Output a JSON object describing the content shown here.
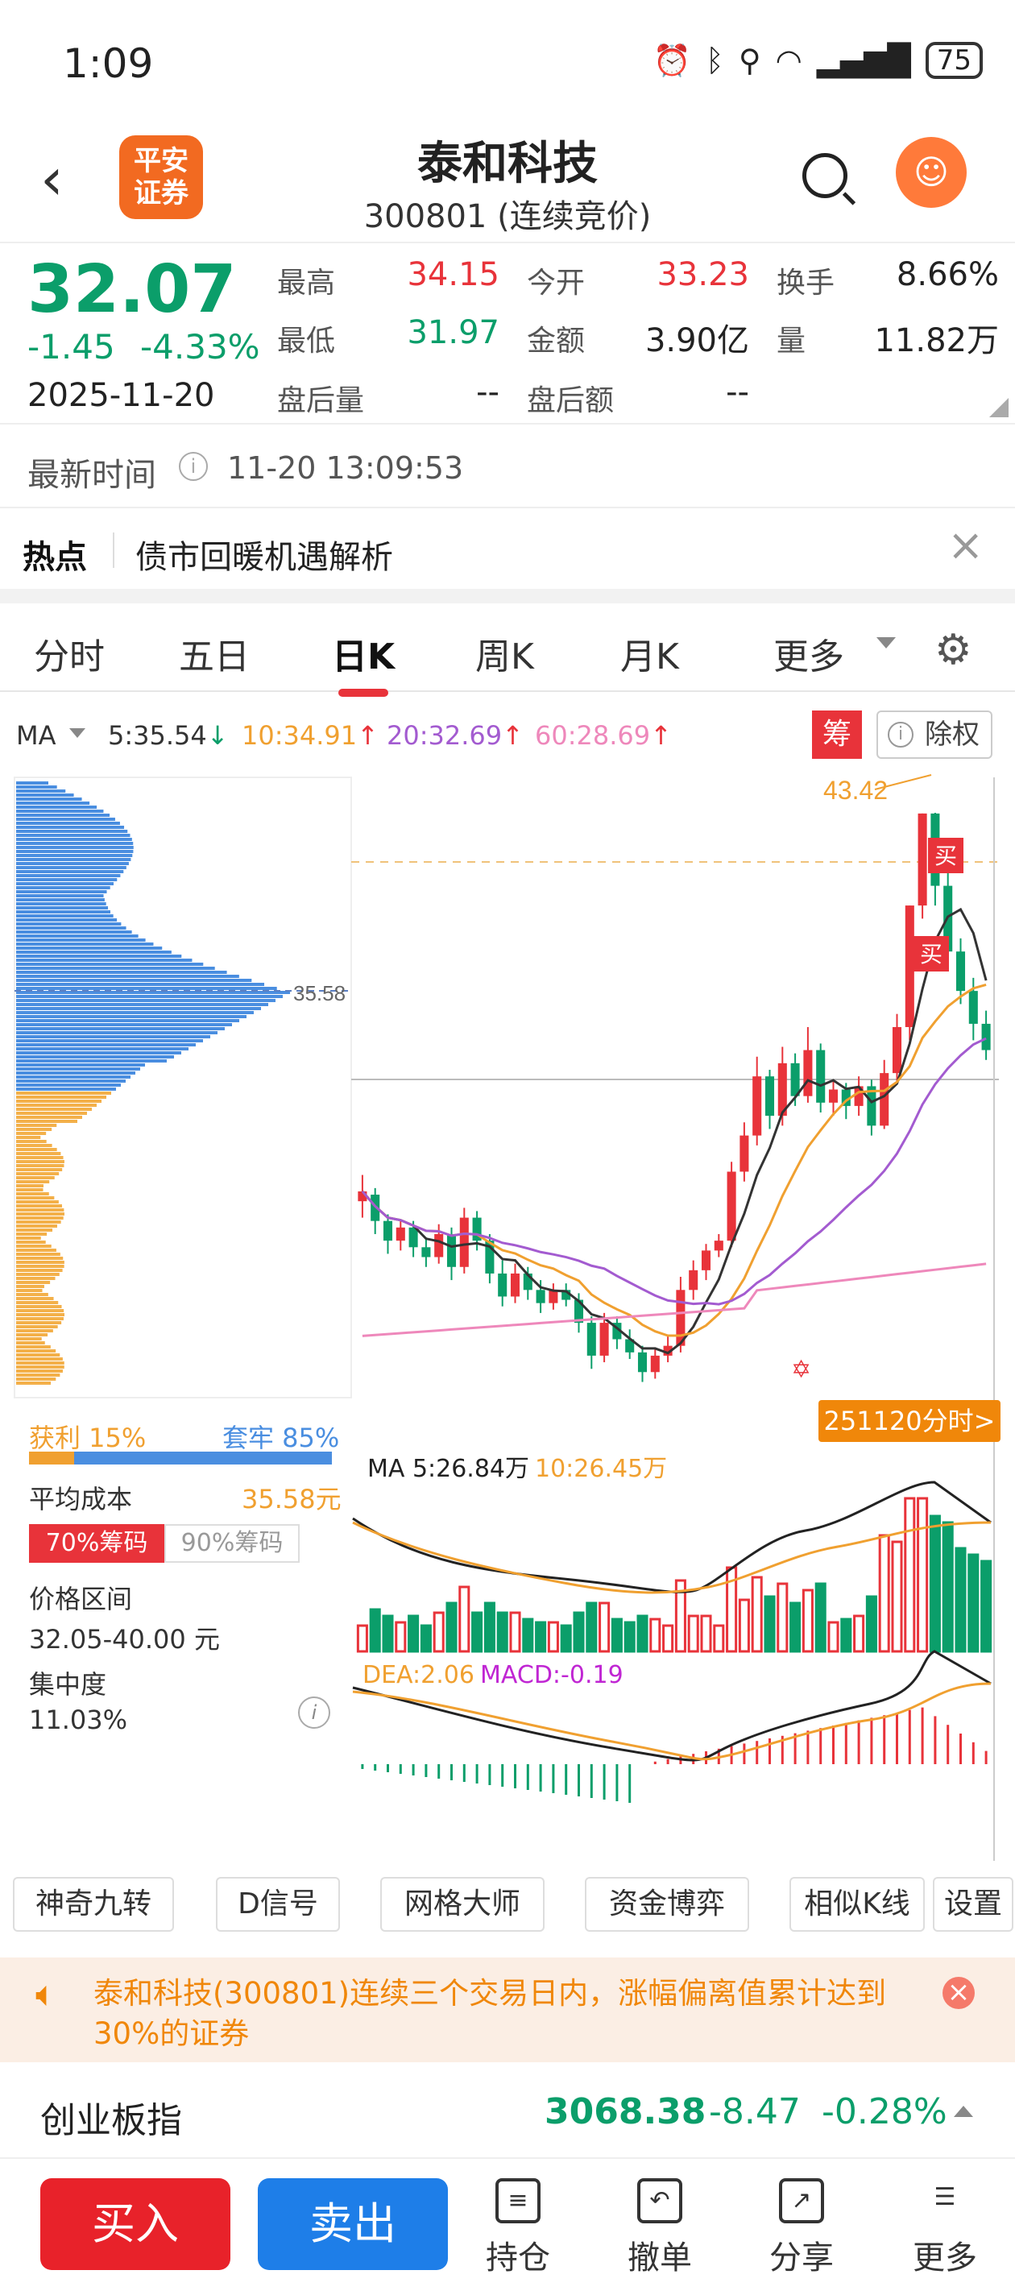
{
  "status": {
    "time": "1:09",
    "battery": "75"
  },
  "header": {
    "logo_text": "平安\n证券",
    "title": "泰和科技",
    "subtitle": "300801 (连续竞价)"
  },
  "quote": {
    "price": "32.07",
    "change": "-1.45",
    "change_pct": "-4.33%",
    "date": "2025-11-20",
    "high_label": "最高",
    "high": "34.15",
    "open_label": "今开",
    "open": "33.23",
    "turnover_label": "换手",
    "turnover": "8.66%",
    "low_label": "最低",
    "low": "31.97",
    "amount_label": "金额",
    "amount": "3.90亿",
    "volume_label": "量",
    "volume": "11.82万",
    "after_vol_label": "盘后量",
    "after_vol": "--",
    "after_amt_label": "盘后额",
    "after_amt": "--"
  },
  "latest": {
    "label": "最新时间",
    "value": "11-20 13:09:53"
  },
  "hot": {
    "label": "热点",
    "text": "债市回暖机遇解析"
  },
  "tabs": [
    "分时",
    "五日",
    "日K",
    "周K",
    "月K",
    "更多"
  ],
  "ma": {
    "label": "MA",
    "ma5": "5:35.54",
    "ma10": "10:34.91",
    "ma20": "20:32.69",
    "ma60": "60:28.69",
    "chip_badge": "筹",
    "fq": "除权"
  },
  "chart": {
    "high_label": "43.42",
    "cost_label": "35.58",
    "buy1": "买",
    "buy2": "买",
    "tag": "251120分时>",
    "vol_line": "MA 5:26.84万",
    "vol_line2": "10:26.45万",
    "macd_dea": "DEA:2.06",
    "macd_val": "MACD:-0.19",
    "profit": "获利 15%",
    "trapped": "套牢 85%",
    "profit_pct": 15,
    "avg_cost_label": "平均成本",
    "avg_cost": "35.58元",
    "chip70": "70%筹码",
    "chip90": "90%筹码",
    "range_label": "价格区间",
    "range": "32.05-40.00 元",
    "conc_label": "集中度",
    "conc": "11.03%"
  },
  "chart_data": {
    "type": "candlestick",
    "candles": [
      {
        "o": 31.6,
        "c": 31.9,
        "h": 32.4,
        "l": 31.1
      },
      {
        "o": 31.8,
        "c": 31.0,
        "h": 32.0,
        "l": 30.6
      },
      {
        "o": 31.0,
        "c": 30.4,
        "h": 31.2,
        "l": 30.0
      },
      {
        "o": 30.4,
        "c": 30.8,
        "h": 31.0,
        "l": 30.1
      },
      {
        "o": 30.8,
        "c": 30.2,
        "h": 31.0,
        "l": 29.9
      },
      {
        "o": 30.2,
        "c": 29.9,
        "h": 30.5,
        "l": 29.6
      },
      {
        "o": 29.9,
        "c": 30.6,
        "h": 30.9,
        "l": 29.7
      },
      {
        "o": 30.6,
        "c": 29.6,
        "h": 30.8,
        "l": 29.2
      },
      {
        "o": 29.6,
        "c": 31.1,
        "h": 31.4,
        "l": 29.4
      },
      {
        "o": 31.1,
        "c": 30.4,
        "h": 31.3,
        "l": 30.1
      },
      {
        "o": 30.4,
        "c": 29.4,
        "h": 30.6,
        "l": 29.1
      },
      {
        "o": 29.4,
        "c": 28.7,
        "h": 29.8,
        "l": 28.4
      },
      {
        "o": 28.7,
        "c": 29.4,
        "h": 29.7,
        "l": 28.5
      },
      {
        "o": 29.4,
        "c": 28.9,
        "h": 29.6,
        "l": 28.6
      },
      {
        "o": 28.9,
        "c": 28.5,
        "h": 29.2,
        "l": 28.2
      },
      {
        "o": 28.5,
        "c": 28.9,
        "h": 29.1,
        "l": 28.3
      },
      {
        "o": 28.9,
        "c": 28.6,
        "h": 29.1,
        "l": 28.4
      },
      {
        "o": 28.6,
        "c": 27.9,
        "h": 28.8,
        "l": 27.6
      },
      {
        "o": 27.9,
        "c": 26.9,
        "h": 28.1,
        "l": 26.5
      },
      {
        "o": 26.9,
        "c": 27.9,
        "h": 28.2,
        "l": 26.7
      },
      {
        "o": 27.9,
        "c": 27.4,
        "h": 28.1,
        "l": 27.1
      },
      {
        "o": 27.4,
        "c": 27.0,
        "h": 27.7,
        "l": 26.8
      },
      {
        "o": 27.0,
        "c": 26.4,
        "h": 27.2,
        "l": 26.1
      },
      {
        "o": 26.4,
        "c": 26.9,
        "h": 27.1,
        "l": 26.2
      },
      {
        "o": 26.9,
        "c": 27.2,
        "h": 27.5,
        "l": 26.7
      },
      {
        "o": 27.2,
        "c": 28.9,
        "h": 29.3,
        "l": 27.0
      },
      {
        "o": 28.9,
        "c": 29.5,
        "h": 29.8,
        "l": 28.6
      },
      {
        "o": 29.5,
        "c": 30.1,
        "h": 30.3,
        "l": 29.2
      },
      {
        "o": 30.1,
        "c": 30.4,
        "h": 30.6,
        "l": 29.9
      },
      {
        "o": 30.4,
        "c": 32.5,
        "h": 32.8,
        "l": 30.2
      },
      {
        "o": 32.5,
        "c": 33.6,
        "h": 34.0,
        "l": 32.2
      },
      {
        "o": 33.6,
        "c": 35.4,
        "h": 36.0,
        "l": 33.3
      },
      {
        "o": 35.4,
        "c": 34.2,
        "h": 35.6,
        "l": 33.8
      },
      {
        "o": 34.2,
        "c": 35.8,
        "h": 36.3,
        "l": 33.9
      },
      {
        "o": 35.8,
        "c": 34.8,
        "h": 36.1,
        "l": 34.5
      },
      {
        "o": 34.8,
        "c": 36.2,
        "h": 36.9,
        "l": 34.6
      },
      {
        "o": 36.2,
        "c": 34.6,
        "h": 36.4,
        "l": 34.3
      },
      {
        "o": 34.6,
        "c": 35.0,
        "h": 35.3,
        "l": 34.2
      },
      {
        "o": 35.0,
        "c": 34.5,
        "h": 35.2,
        "l": 34.1
      },
      {
        "o": 34.5,
        "c": 35.1,
        "h": 35.4,
        "l": 34.2
      },
      {
        "o": 35.1,
        "c": 33.9,
        "h": 35.3,
        "l": 33.6
      },
      {
        "o": 33.9,
        "c": 35.5,
        "h": 35.9,
        "l": 33.8
      },
      {
        "o": 35.5,
        "c": 36.9,
        "h": 37.3,
        "l": 35.2
      },
      {
        "o": 36.9,
        "c": 40.6,
        "h": 40.6,
        "l": 36.5
      },
      {
        "o": 40.6,
        "c": 43.4,
        "h": 43.4,
        "l": 40.2
      },
      {
        "o": 43.4,
        "c": 41.2,
        "h": 43.42,
        "l": 40.6
      },
      {
        "o": 41.2,
        "c": 39.2,
        "h": 41.6,
        "l": 38.7
      },
      {
        "o": 39.2,
        "c": 38.0,
        "h": 39.6,
        "l": 37.6
      },
      {
        "o": 38.0,
        "c": 37.0,
        "h": 38.4,
        "l": 36.5
      },
      {
        "o": 37.0,
        "c": 36.2,
        "h": 37.4,
        "l": 35.9
      }
    ],
    "ylim": [
      25.5,
      44.5
    ]
  },
  "tools": [
    "神奇九转",
    "D信号",
    "网格大师",
    "资金博弈",
    "相似K线",
    "设置"
  ],
  "notice": {
    "text": "泰和科技(300801)连续三个交易日内，涨幅偏离值累计达到30%的证券"
  },
  "index": {
    "name": "创业板指",
    "value": "3068.38",
    "change": "-8.47",
    "pct": "-0.28%"
  },
  "bottom": {
    "buy": "买入",
    "sell": "卖出",
    "hold": "持仓",
    "cancel": "撤单",
    "share": "分享",
    "more": "更多"
  },
  "colors": {
    "up": "#e8333a",
    "down": "#0b9e6a",
    "ma5": "#333333",
    "ma10": "#f0a030",
    "ma20": "#a35bd0",
    "ma60": "#ee88bb"
  }
}
